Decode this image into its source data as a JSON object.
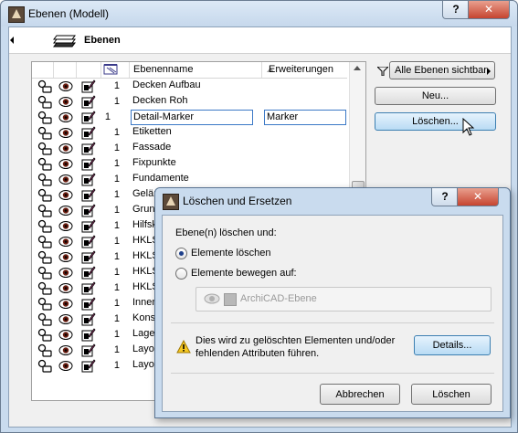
{
  "window": {
    "title": "Ebenen (Modell)",
    "help_label": "?",
    "close_label": "✕"
  },
  "panel": {
    "title": "Ebenen",
    "icon": "layers-icon"
  },
  "table": {
    "columns": [
      "Ebenenname",
      "Erweiterungen"
    ],
    "rows": [
      {
        "num": "1",
        "name": "Decken Aufbau",
        "ext": ""
      },
      {
        "num": "1",
        "name": "Decken Roh",
        "ext": ""
      },
      {
        "num": "1",
        "name": "Detail-Marker",
        "ext": "Marker",
        "selected": true
      },
      {
        "num": "1",
        "name": "Etiketten",
        "ext": ""
      },
      {
        "num": "1",
        "name": "Fassade",
        "ext": ""
      },
      {
        "num": "1",
        "name": "Fixpunkte",
        "ext": ""
      },
      {
        "num": "1",
        "name": "Fundamente",
        "ext": ""
      },
      {
        "num": "1",
        "name": "Gelär",
        "ext": ""
      },
      {
        "num": "1",
        "name": "Grund",
        "ext": ""
      },
      {
        "num": "1",
        "name": "Hilfsk",
        "ext": ""
      },
      {
        "num": "1",
        "name": "HKLS",
        "ext": ""
      },
      {
        "num": "1",
        "name": "HKLS",
        "ext": ""
      },
      {
        "num": "1",
        "name": "HKLS",
        "ext": ""
      },
      {
        "num": "1",
        "name": "HKLS",
        "ext": ""
      },
      {
        "num": "1",
        "name": "Innen",
        "ext": ""
      },
      {
        "num": "1",
        "name": "Konst",
        "ext": ""
      },
      {
        "num": "1",
        "name": "Lager",
        "ext": ""
      },
      {
        "num": "1",
        "name": "Layou",
        "ext": ""
      },
      {
        "num": "1",
        "name": "Layou",
        "ext": ""
      }
    ]
  },
  "sidebar": {
    "filter_label": "Alle Ebenen sichtbar",
    "new_label": "Neu...",
    "delete_label": "Löschen..."
  },
  "dialog": {
    "title": "Löschen und Ersetzen",
    "help_label": "?",
    "close_label": "✕",
    "section_label": "Ebene(n) löschen und:",
    "option_delete": "Elemente löschen",
    "option_move": "Elemente bewegen auf:",
    "target_layer": "ArchiCAD-Ebene",
    "warning_text_1": "Dies wird zu gelöschten Elementen und/oder",
    "warning_text_2": "fehlenden Attributen führen.",
    "details_label": "Details...",
    "cancel_label": "Abbrechen",
    "confirm_label": "Löschen"
  }
}
